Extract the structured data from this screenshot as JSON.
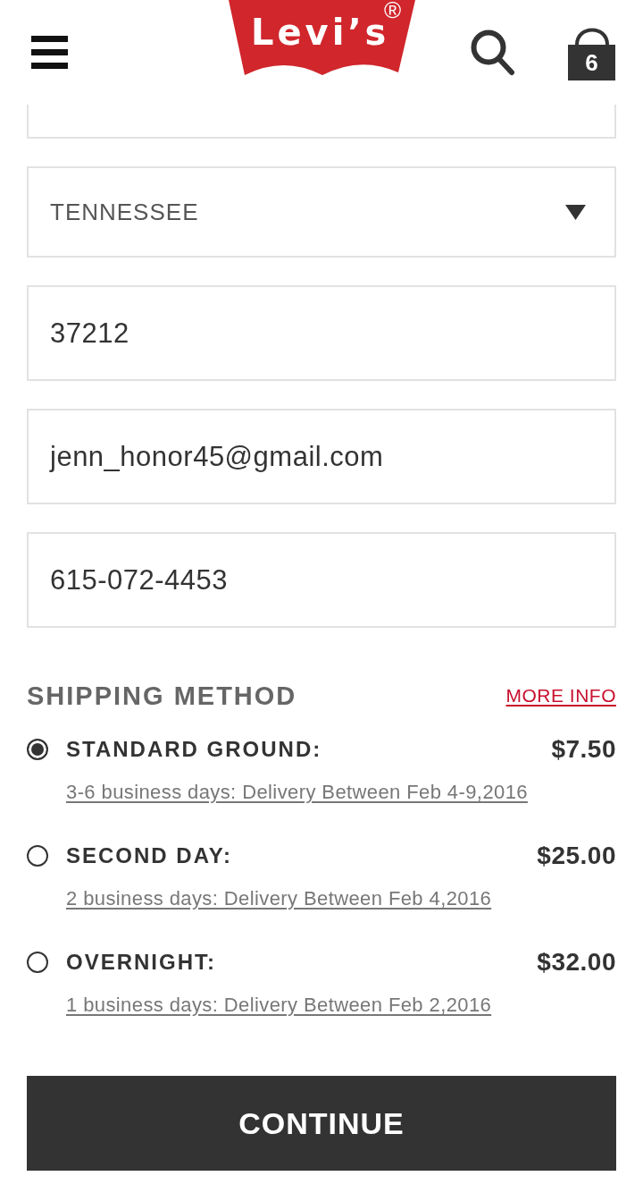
{
  "header": {
    "logo": {
      "text": "Levi’s",
      "mark": "®"
    },
    "cart_count": "6"
  },
  "fields": [
    {
      "kind": "text",
      "cut": true
    },
    {
      "kind": "select",
      "value": "TENNESSEE",
      "cut": false
    },
    {
      "kind": "text",
      "value": "37212",
      "cut": false
    },
    {
      "kind": "text",
      "value": "jenn_honor45@gmail.com",
      "cut": false
    },
    {
      "kind": "text",
      "value": "615-072-4453",
      "cut": false
    }
  ],
  "shipping": {
    "title": "SHIPPING METHOD",
    "more_info": "MORE INFO",
    "options": [
      {
        "name": "STANDARD GROUND:",
        "price": "$7.50",
        "details": "3-6 business days: Delivery Between Feb 4-9,2016",
        "selected": true
      },
      {
        "name": "SECOND DAY:",
        "price": "$25.00",
        "details": "2 business days: Delivery Between Feb 4,2016",
        "selected": false
      },
      {
        "name": "OVERNIGHT:",
        "price": "$32.00",
        "details": "1 business days: Delivery Between Feb 2,2016",
        "selected": false
      }
    ]
  },
  "continue_button": "CONTINUE"
}
